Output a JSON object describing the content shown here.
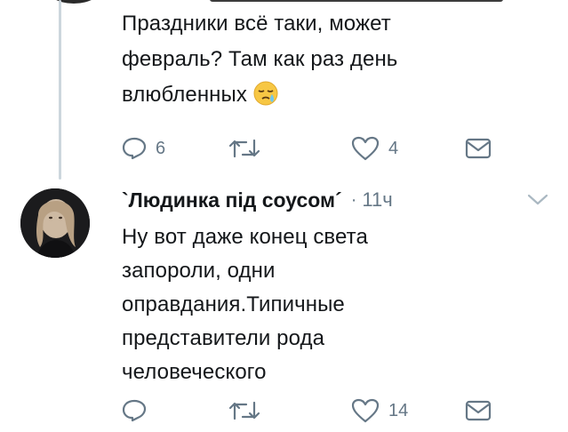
{
  "tweet1": {
    "text_line1": "Праздники всё таки, может",
    "text_line2": "февраль?  Там как раз день",
    "text_line3": "влюбленных",
    "emoji": "sleepy-face-icon",
    "actions": {
      "reply_count": "6",
      "retweet_count": "",
      "like_count": "4"
    }
  },
  "tweet2": {
    "author_name": "`Людинка під соусом´",
    "separator": "·",
    "time": "11ч",
    "text_lines": [
      "Ну вот даже конец света",
      "запороли, одни",
      "оправдания.Типичные",
      "представители рода",
      "человеческого"
    ],
    "actions": {
      "reply_count": "",
      "retweet_count": "",
      "like_count": "14"
    }
  },
  "icons": [
    "reply-icon",
    "retweet-icon",
    "like-icon",
    "message-icon",
    "chevron-down-icon"
  ],
  "colors": {
    "action_gray": "#657786",
    "text": "#14171a",
    "thread_line": "#ccd6dd"
  }
}
